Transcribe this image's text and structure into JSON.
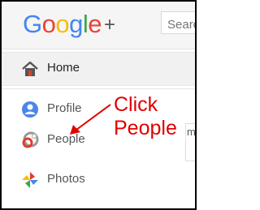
{
  "header": {
    "logo": {
      "g1": "G",
      "o1": "o",
      "o2": "o",
      "g2": "g",
      "l": "l",
      "e": "e",
      "plus": "+"
    },
    "search_placeholder": "Search"
  },
  "sidebar": {
    "items": [
      {
        "label": "Home",
        "icon": "home-icon"
      },
      {
        "label": "Profile",
        "icon": "profile-icon"
      },
      {
        "label": "People",
        "icon": "people-circles-icon"
      },
      {
        "label": "Photos",
        "icon": "photos-pinwheel-icon"
      }
    ]
  },
  "annotation": {
    "line1": "Click",
    "line2": "People",
    "color": "#e00000"
  },
  "partial_text": "ma"
}
